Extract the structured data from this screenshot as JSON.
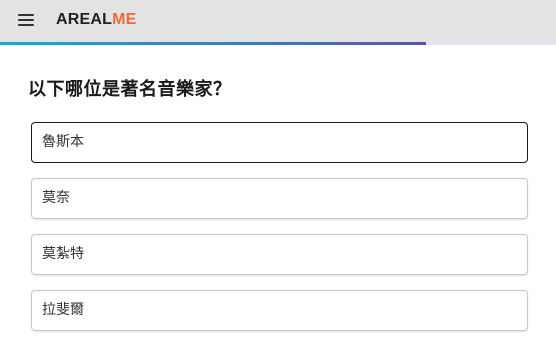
{
  "header": {
    "logo_part1": "AREAL",
    "logo_part2": "ME",
    "menu_icon": "hamburger-menu-icon",
    "logo_accent_color": "#ef6a3a"
  },
  "progress": {
    "fraction": 0.766,
    "gradient_start": "#2aa4cf",
    "gradient_end": "#5a57a6"
  },
  "quiz": {
    "question": "以下哪位是著名音樂家？",
    "options": [
      {
        "label": "魯斯本",
        "focused": true
      },
      {
        "label": "莫奈",
        "focused": false
      },
      {
        "label": "莫紮特",
        "focused": false
      },
      {
        "label": "拉斐爾",
        "focused": false
      }
    ]
  }
}
